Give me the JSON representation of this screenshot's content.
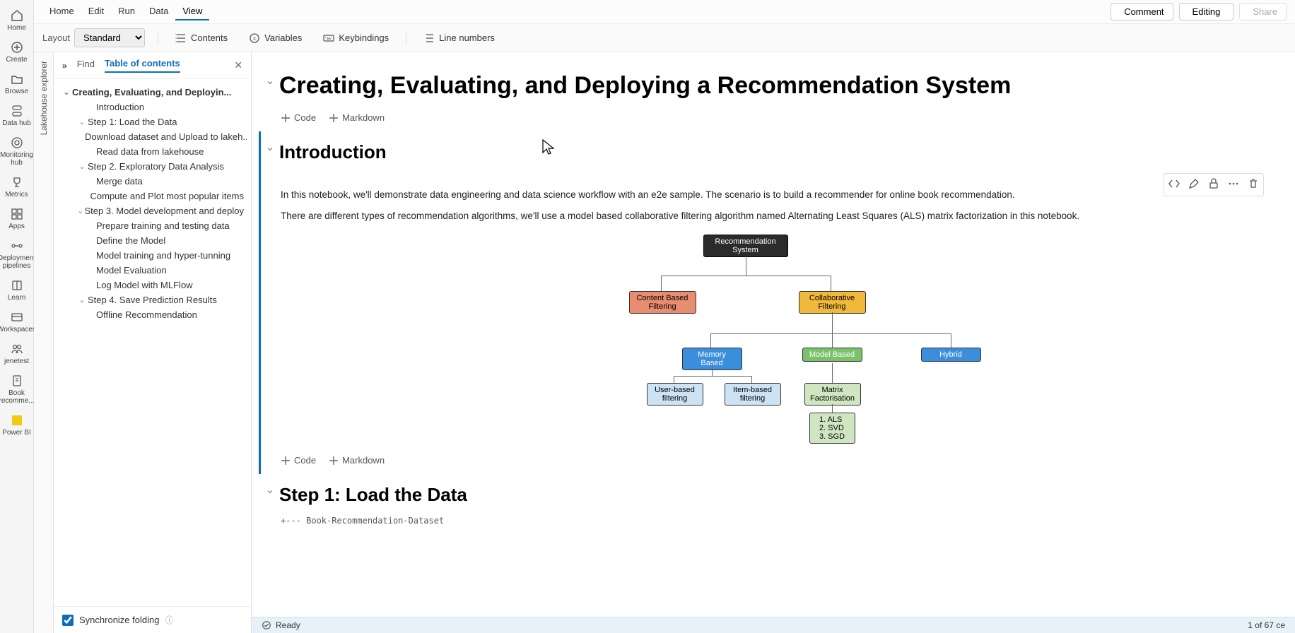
{
  "leftRail": [
    {
      "label": "Home",
      "icon": "home"
    },
    {
      "label": "Create",
      "icon": "plus"
    },
    {
      "label": "Browse",
      "icon": "folder"
    },
    {
      "label": "Data hub",
      "icon": "datahub"
    },
    {
      "label": "Monitoring hub",
      "icon": "monitor"
    },
    {
      "label": "Metrics",
      "icon": "trophy"
    },
    {
      "label": "Apps",
      "icon": "apps"
    },
    {
      "label": "Deployment pipelines",
      "icon": "pipeline"
    },
    {
      "label": "Learn",
      "icon": "learn"
    },
    {
      "label": "Workspaces",
      "icon": "workspaces"
    },
    {
      "label": "jenetest",
      "icon": "people"
    },
    {
      "label": "Book recomme...",
      "icon": "notebook"
    },
    {
      "label": "Power BI",
      "icon": "pbi"
    }
  ],
  "menu": {
    "items": [
      "Home",
      "Edit",
      "Run",
      "Data",
      "View"
    ],
    "active": "View"
  },
  "topRight": {
    "comment": "Comment",
    "editing": "Editing",
    "share": "Share"
  },
  "toolbar": {
    "layoutLabel": "Layout",
    "layoutValue": "Standard",
    "contents": "Contents",
    "variables": "Variables",
    "keybindings": "Keybindings",
    "linenumbers": "Line numbers"
  },
  "verticalTab": "Lakehouse explorer",
  "tocHeader": {
    "find": "Find",
    "toc": "Table of contents"
  },
  "toc": [
    {
      "label": "Creating, Evaluating, and Deployin...",
      "level": 0,
      "chev": true,
      "bold": true
    },
    {
      "label": "Introduction",
      "level": 2
    },
    {
      "label": "Step 1: Load the Data",
      "level": 1,
      "chev": true
    },
    {
      "label": "Download dataset and Upload to lakeh...",
      "level": 2
    },
    {
      "label": "Read data from lakehouse",
      "level": 2
    },
    {
      "label": "Step 2. Exploratory Data Analysis",
      "level": 1,
      "chev": true
    },
    {
      "label": "Merge data",
      "level": 2
    },
    {
      "label": "Compute and Plot most popular items",
      "level": 2
    },
    {
      "label": "Step 3. Model development and deploy",
      "level": 1,
      "chev": true
    },
    {
      "label": "Prepare training and testing data",
      "level": 2
    },
    {
      "label": "Define the Model",
      "level": 2
    },
    {
      "label": "Model training and hyper-tunning",
      "level": 2
    },
    {
      "label": "Model Evaluation",
      "level": 2
    },
    {
      "label": "Log Model with MLFlow",
      "level": 2
    },
    {
      "label": "Step 4. Save Prediction Results",
      "level": 1,
      "chev": true
    },
    {
      "label": "Offline Recommendation",
      "level": 2
    }
  ],
  "syncFolding": "Synchronize folding",
  "notebook": {
    "title": "Creating, Evaluating, and Deploying a Recommendation System",
    "code": "Code",
    "markdown": "Markdown",
    "introHeading": "Introduction",
    "para1": "In this notebook, we'll demonstrate data engineering and data science workflow with an e2e sample. The scenario is to build a recommender for online book recommendation.",
    "para2": "There are different types of recommendation algorithms, we'll use a model based collaborative filtering algorithm named Alternating Least Squares (ALS) matrix factorization in this notebook.",
    "step1": "Step 1: Load the Data",
    "codePreview": "+--- Book-Recommendation-Dataset"
  },
  "diagram": {
    "root": "Recommendation\nSystem",
    "content": "Content Based\nFiltering",
    "collab": "Collaborative\nFiltering",
    "memory": "Memory Based",
    "model": "Model Based",
    "hybrid": "Hybrid",
    "user": "User-based\nfiltering",
    "item": "Item-based\nfiltering",
    "matrix": "Matrix\nFactorisation",
    "algos": "1. ALS\n2. SVD\n3. SGD"
  },
  "status": {
    "ready": "Ready",
    "counter": "1 of 67 ce"
  }
}
